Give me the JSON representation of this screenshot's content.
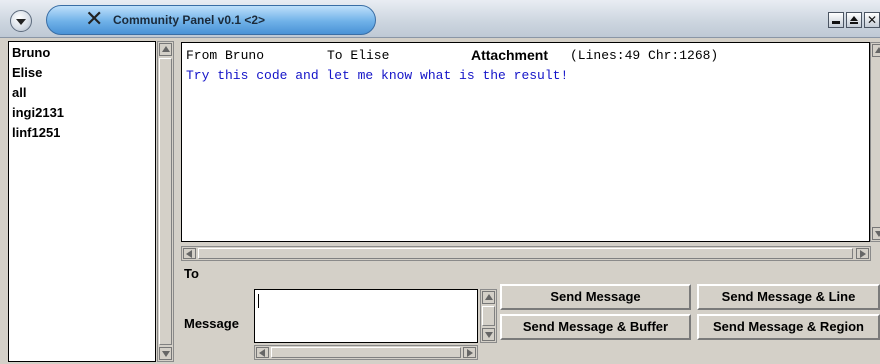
{
  "window": {
    "title": "Community Panel v0.1 <2>",
    "menu_icon": "chevron-down-icon",
    "app_icon": "x-logo-icon",
    "controls": [
      "minimize-icon",
      "maximize-icon",
      "close-icon"
    ],
    "close_glyph": "✕"
  },
  "users": [
    "Bruno",
    "Elise",
    "all",
    "ingi2131",
    "linf1251"
  ],
  "message": {
    "from": "From Bruno",
    "to": "To Elise",
    "attachment_label": "Attachment",
    "attachment_info": "(Lines:49 Chr:1268)",
    "body": "Try this code and let me know what is the result!",
    "body_color": "#1414c8"
  },
  "compose": {
    "to_label": "To",
    "message_label": "Message",
    "message_value": ""
  },
  "buttons": {
    "send_message": "Send Message",
    "send_message_line": "Send Message & Line",
    "send_message_buffer": "Send Message & Buffer",
    "send_message_region": "Send Message & Region"
  }
}
